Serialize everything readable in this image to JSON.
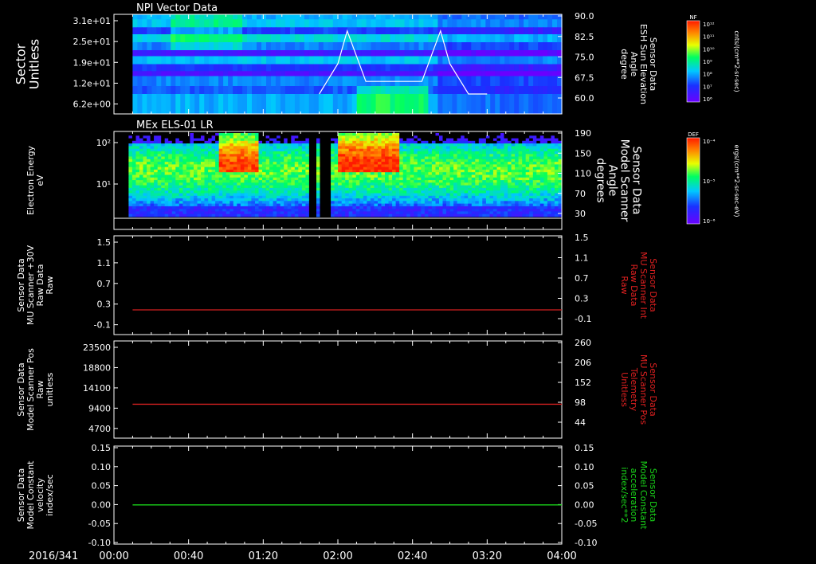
{
  "date_label": "2016/341",
  "time_ticks": [
    "00:00",
    "00:40",
    "01:20",
    "02:00",
    "02:40",
    "03:20",
    "04:00"
  ],
  "panels": [
    {
      "title": "NPI Vector Data",
      "left_label": [
        "Sector",
        "Unitless"
      ],
      "left_ticks": [
        "3.1e+01",
        "2.5e+01",
        "1.9e+01",
        "1.2e+01",
        "6.2e+00"
      ],
      "right_ticks": [
        "90.0",
        "82.5",
        "75.0",
        "67.5",
        "60.0"
      ],
      "right_label": [
        "Sensor Data",
        "ESH Sun Elevation",
        "Angle",
        "degree"
      ],
      "colorbar": {
        "label": "NF",
        "units": "cnts/(cm**2-sr-sec)",
        "ticks": [
          "10¹²",
          "10¹¹",
          "10¹⁰",
          "10⁹",
          "10⁸",
          "10⁷",
          "10⁶"
        ]
      }
    },
    {
      "title": "MEx ELS-01 LR",
      "left_label": [
        "Electron Energy",
        "eV"
      ],
      "left_ticks": [
        "10²",
        "10¹"
      ],
      "right_ticks": [
        "190",
        "150",
        "110",
        "70",
        "30"
      ],
      "right_label": [
        "Sensor Data",
        "Model Scanner",
        "Angle",
        "degrees"
      ],
      "colorbar": {
        "label": "DEF",
        "units": "ergs/(cm**2-sr-sec-eV)",
        "ticks": [
          "10⁻⁴",
          "10⁻⁵",
          "10⁻⁶"
        ]
      }
    },
    {
      "left_label": [
        "Sensor Data",
        "MU Scanner +30V",
        "Raw Data",
        "Raw"
      ],
      "left_ticks": [
        "1.5",
        "1.1",
        "0.7",
        "0.3",
        "-0.1"
      ],
      "right_ticks": [
        "1.5",
        "1.1",
        "0.7",
        "0.3",
        "-0.1"
      ],
      "right_label": [
        "Sensor Data",
        "MU Scanner Int",
        "Raw Data",
        "Raw"
      ],
      "line_color": "#d42020"
    },
    {
      "left_label": [
        "Sensor Data",
        "Model Scanner Pos",
        "Raw",
        "unitless"
      ],
      "left_ticks": [
        "23500",
        "18800",
        "14100",
        "9400",
        "4700"
      ],
      "right_ticks": [
        "260",
        "206",
        "152",
        "98",
        "44"
      ],
      "right_label": [
        "Sensor Data",
        "MU Scanner Pos",
        "Telemetry",
        "Unitless"
      ],
      "line_color": "#d42020"
    },
    {
      "left_label": [
        "Sensor Data",
        "Model Constant",
        "velocity",
        "index/sec"
      ],
      "left_ticks": [
        "0.15",
        "0.10",
        "0.05",
        "0.00",
        "-0.05",
        "-0.10"
      ],
      "right_ticks": [
        "0.15",
        "0.10",
        "0.05",
        "0.00",
        "-0.05",
        "-0.10"
      ],
      "right_label": [
        "Sensor Data",
        "Model Constant",
        "acceleration",
        "index/sec**2"
      ],
      "line_color": "#19d419"
    }
  ],
  "colors": {
    "right_label_red": "#e02020",
    "right_label_green": "#19d419",
    "frame": "#ffffff"
  },
  "chart_data": [
    {
      "type": "heatmap",
      "title": "NPI Vector Data",
      "x_range": [
        "00:00",
        "04:00"
      ],
      "ylabel": "Sector Unitless",
      "ylim": [
        0,
        31
      ],
      "overlay_series": [
        {
          "name": "Sensor Data ESH Sun Elevation Angle",
          "x": [
            "01:50",
            "02:00",
            "02:05",
            "02:15",
            "02:45",
            "02:55",
            "03:00",
            "03:10",
            "03:20"
          ],
          "y": [
            60,
            72,
            85,
            65,
            65,
            85,
            72,
            60,
            60
          ]
        }
      ]
    },
    {
      "type": "heatmap",
      "title": "MEx ELS-01 LR",
      "x_range": [
        "00:00",
        "04:00"
      ],
      "ylabel": "Electron Energy eV",
      "y_scale": "log"
    },
    {
      "type": "line",
      "x": [
        "00:10",
        "04:00"
      ],
      "y": [
        0.15,
        0.15
      ],
      "ylim": [
        -0.3,
        1.5
      ]
    },
    {
      "type": "line",
      "x": [
        "00:10",
        "04:00"
      ],
      "y": [
        8200,
        8200
      ],
      "ylim": [
        0,
        23500
      ]
    },
    {
      "type": "line",
      "x": [
        "00:10",
        "04:00"
      ],
      "y": [
        0.0,
        0.0
      ],
      "ylim": [
        -0.1,
        0.15
      ]
    }
  ]
}
